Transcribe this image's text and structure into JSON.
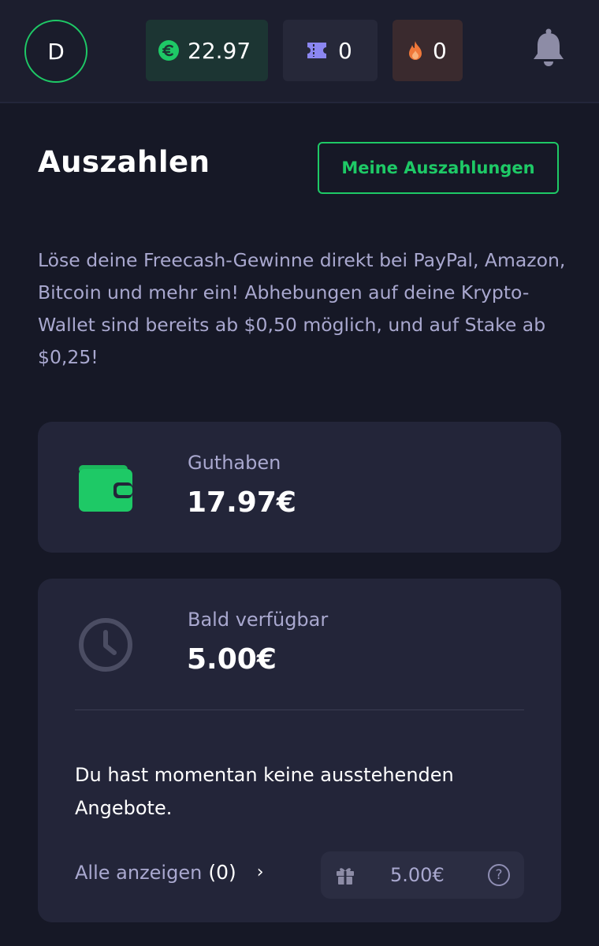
{
  "header": {
    "avatar_initial": "D",
    "cash_balance": "22.97",
    "tickets": "0",
    "streak": "0",
    "cash_icon": "euro-icon",
    "tickets_icon": "ticket-icon",
    "streak_icon": "flame-icon",
    "bell_icon": "bell-icon"
  },
  "page": {
    "title": "Auszahlen",
    "my_withdrawals_button": "Meine Auszahlungen",
    "intro": "Löse deine Freecash-Gewinne direkt bei PayPal, Amazon, Bitcoin und mehr ein! Abhebungen auf deine Krypto-Wallet sind bereits ab $0,50 möglich, und auf Stake ab $0,25!"
  },
  "balance_card": {
    "icon": "wallet-icon",
    "label": "Guthaben",
    "amount": "17.97€"
  },
  "pending_card": {
    "icon": "clock-icon",
    "label": "Bald verfügbar",
    "amount": "5.00€",
    "empty_message": "Du hast momentan keine ausstehenden Angebote.",
    "show_all_label": "Alle anzeigen",
    "show_all_count": "(0)",
    "pill_icon": "gift-icon",
    "pill_amount": "5.00€",
    "help_symbol": "?"
  },
  "colors": {
    "accent_green": "#1ec966",
    "background": "#161826",
    "card": "#232539",
    "muted_text": "#a9a8cf",
    "ticket_purple": "#8b86f0",
    "flame_orange": "#f0783a"
  }
}
